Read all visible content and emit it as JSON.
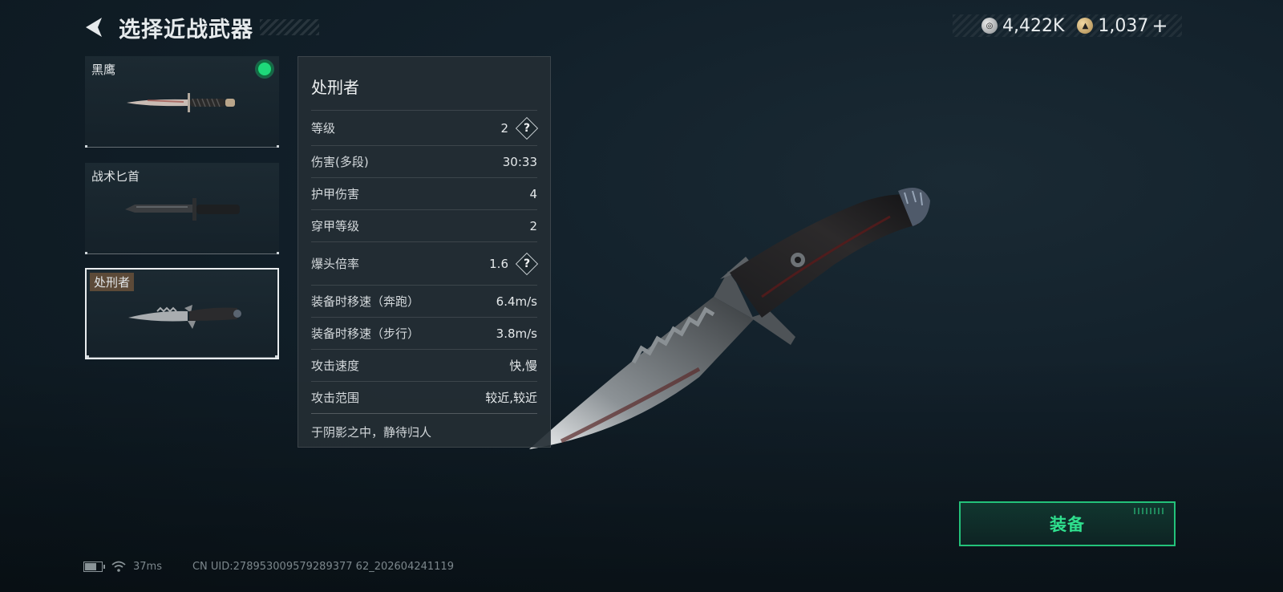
{
  "header": {
    "title": "选择近战武器"
  },
  "currency": {
    "silver_amount": "4,422K",
    "gold_amount": "1,037",
    "add_label": "+"
  },
  "weapons": [
    {
      "name": "黑鹰",
      "equipped": true,
      "selected": false
    },
    {
      "name": "战术匕首",
      "equipped": false,
      "selected": false
    },
    {
      "name": "处刑者",
      "equipped": false,
      "selected": true
    }
  ],
  "stats": {
    "title": "处刑者",
    "rows": [
      {
        "label": "等级",
        "value": "2",
        "help": true
      },
      {
        "label": "伤害(多段)",
        "value": "30:33",
        "help": false
      },
      {
        "label": "护甲伤害",
        "value": "4",
        "help": false
      },
      {
        "label": "穿甲等级",
        "value": "2",
        "help": false
      },
      {
        "label": "爆头倍率",
        "value": "1.6",
        "help": true
      },
      {
        "label": "装备时移速（奔跑）",
        "value": "6.4m/s",
        "help": false
      },
      {
        "label": "装备时移速（步行）",
        "value": "3.8m/s",
        "help": false
      },
      {
        "label": "攻击速度",
        "value": "快,慢",
        "help": false
      },
      {
        "label": "攻击范围",
        "value": "较近,较近",
        "help": false
      }
    ],
    "help_glyph": "?",
    "description": "于阴影之中，静待归人"
  },
  "equip_button": {
    "label": "装备"
  },
  "footer": {
    "ping": "37ms",
    "uid": "CN UID:278953009579289377 62_202604241119"
  },
  "colors": {
    "accent_green": "#23c27a",
    "equipped_dot": "#1ed87a"
  },
  "icons": [
    "back-arrow-icon",
    "silver-coin-icon",
    "gold-coin-icon",
    "help-icon",
    "battery-icon",
    "wifi-icon"
  ]
}
